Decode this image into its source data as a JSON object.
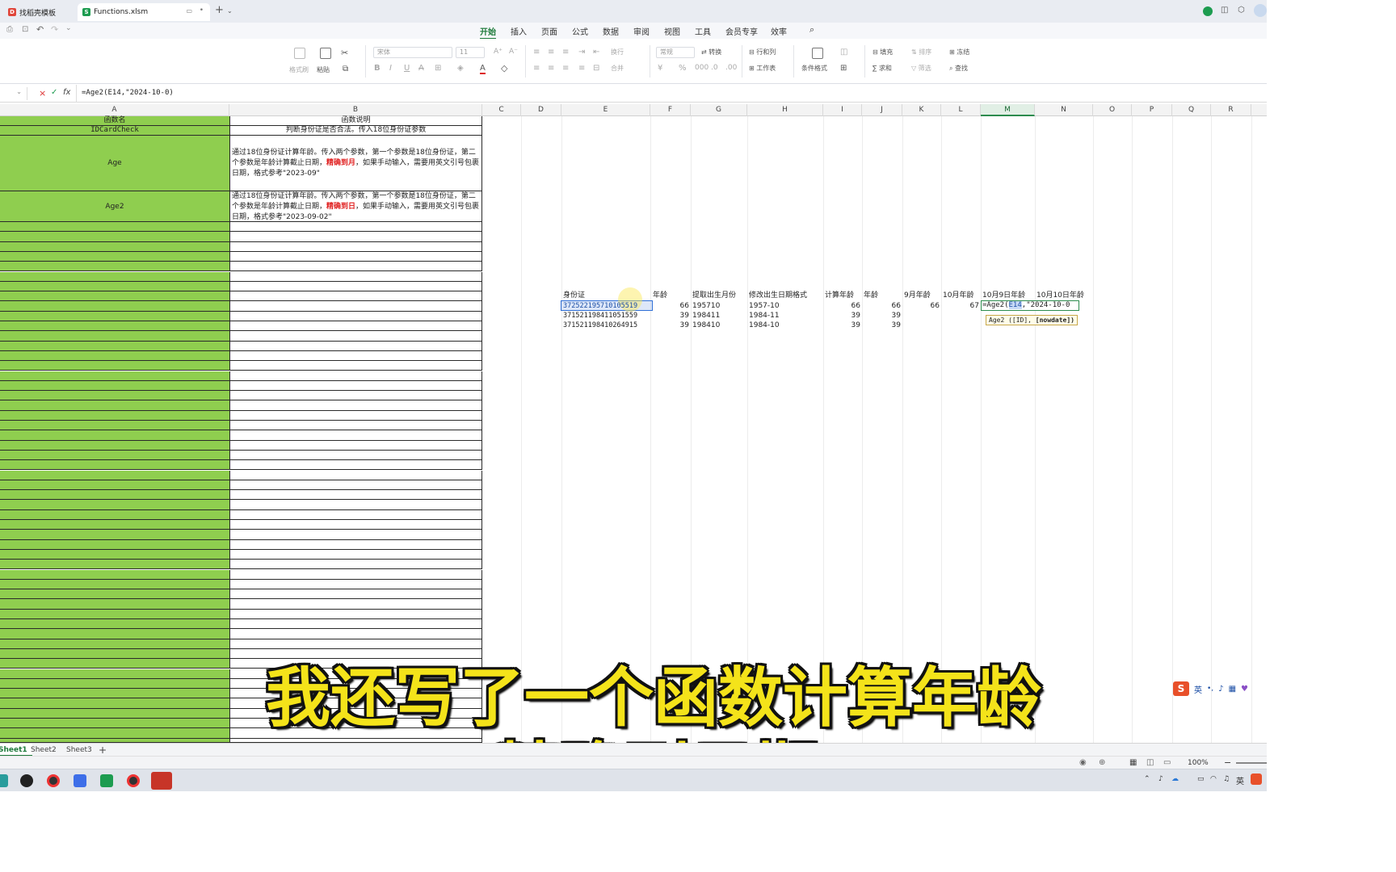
{
  "titlebar": {
    "tabs": [
      {
        "label": "找稻壳模板",
        "icon": "D"
      },
      {
        "label": "Functions.xlsm",
        "icon": "S"
      }
    ],
    "new_tab": "+"
  },
  "menu": {
    "items": [
      "开始",
      "插入",
      "页面",
      "公式",
      "数据",
      "审阅",
      "视图",
      "工具",
      "会员专享",
      "效率"
    ],
    "active": "开始"
  },
  "ribbon": {
    "format_painter": "格式刷",
    "paste": "粘贴",
    "font_name": "宋体",
    "font_size": "11",
    "wrap": "换行",
    "merge": "合并",
    "number_format": "常规",
    "convert": "转换",
    "row_col": "行和列",
    "worksheet": "工作表",
    "cond_format": "条件格式",
    "fill": "填充",
    "sort": "排序",
    "freeze": "冻结",
    "sum": "求和",
    "filter": "筛选",
    "find": "查找"
  },
  "formula_bar": {
    "cell_ref": "",
    "formula": "=Age2(E14,\"2024-10-0)"
  },
  "columns": [
    "A",
    "B",
    "C",
    "D",
    "E",
    "F",
    "G",
    "H",
    "I",
    "J",
    "K",
    "L",
    "M",
    "N",
    "O",
    "P",
    "Q",
    "R"
  ],
  "selected_column": "M",
  "sheet_table": {
    "header": {
      "name": "函数名",
      "desc": "函数说明"
    },
    "rows": [
      {
        "name": "IDCardCheck",
        "desc": "判断身份证是否合法。传入18位身份证参数"
      },
      {
        "name": "Age",
        "desc_pre": "通过18位身份证计算年龄。传入两个参数，第一个参数是18位身份证，第二个参数是年龄计算截止日期，",
        "desc_em": "精确到月",
        "desc_post": "，如果手动输入，需要用英文引号包裹日期，格式参考\"2023-09\""
      },
      {
        "name": "Age2",
        "desc_pre": "通过18位身份证计算年龄。传入两个参数，第一个参数是18位身份证，第二个参数是年龄计算截止日期，",
        "desc_em": "精确到日",
        "desc_post": "，如果手动输入，需要用英文引号包裹日期，格式参考\"2023-09-02\""
      }
    ]
  },
  "data_table": {
    "headers": {
      "id": "身份证",
      "age": "年龄",
      "birth": "提取出生月份",
      "birth_fmt": "修改出生日期格式",
      "calc_age": "计算年龄",
      "age2": "年龄",
      "sep_age": "9月年龄",
      "oct_age": "10月年龄",
      "oct9_age": "10月9日年龄",
      "oct10_age": "10月10日年龄"
    },
    "rows": [
      {
        "id": "372522195710105519",
        "age": "66",
        "birth": "195710",
        "birth_fmt": "1957-10",
        "calc_age": "66",
        "age2": "66",
        "sep_age": "66",
        "oct_age": "67"
      },
      {
        "id": "371521198411051559",
        "age": "39",
        "birth": "198411",
        "birth_fmt": "1984-11",
        "calc_age": "39",
        "age2": "39"
      },
      {
        "id": "371521198410264915",
        "age": "39",
        "birth": "198410",
        "birth_fmt": "1984-10",
        "calc_age": "39",
        "age2": "39"
      }
    ],
    "editing_cell": {
      "prefix": "=Age2(",
      "ref": "E14",
      "suffix": ",\"2024-10-0"
    },
    "tooltip": {
      "text": "Age2 ([ID], ",
      "bold": "[nowdate])"
    }
  },
  "ime": {
    "label": "英"
  },
  "subtitles": {
    "line1": "我还写了一个函数计算年龄",
    "line2": "精确到日期"
  },
  "sheet_tabs": [
    "Sheet1",
    "Sheet2",
    "Sheet3"
  ],
  "add_sheet": "+",
  "status": {
    "zoom": "100%"
  },
  "taskbar": {
    "lang": "英"
  }
}
